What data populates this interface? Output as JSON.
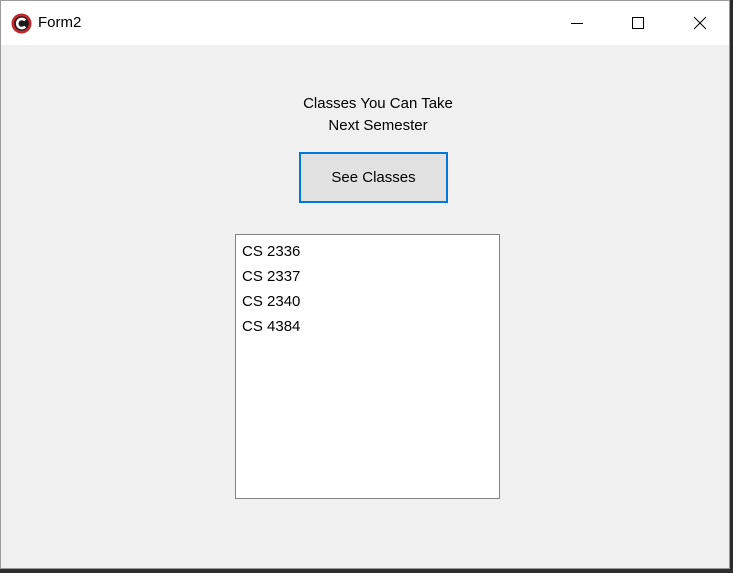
{
  "window": {
    "title": "Form2",
    "icon": "app-logo-icon",
    "controls": {
      "minimize": "minimize-icon",
      "maximize": "maximize-icon",
      "close": "close-icon"
    }
  },
  "form": {
    "heading_line1": "Classes You Can Take",
    "heading_line2": "Next Semester",
    "see_classes_label": "See Classes",
    "classes": [
      "CS 2336",
      "CS 2337",
      "CS 2340",
      "CS 4384"
    ]
  },
  "colors": {
    "accent": "#0078d7",
    "app_icon_red": "#c1272d",
    "form_background": "#f0f0f0"
  }
}
